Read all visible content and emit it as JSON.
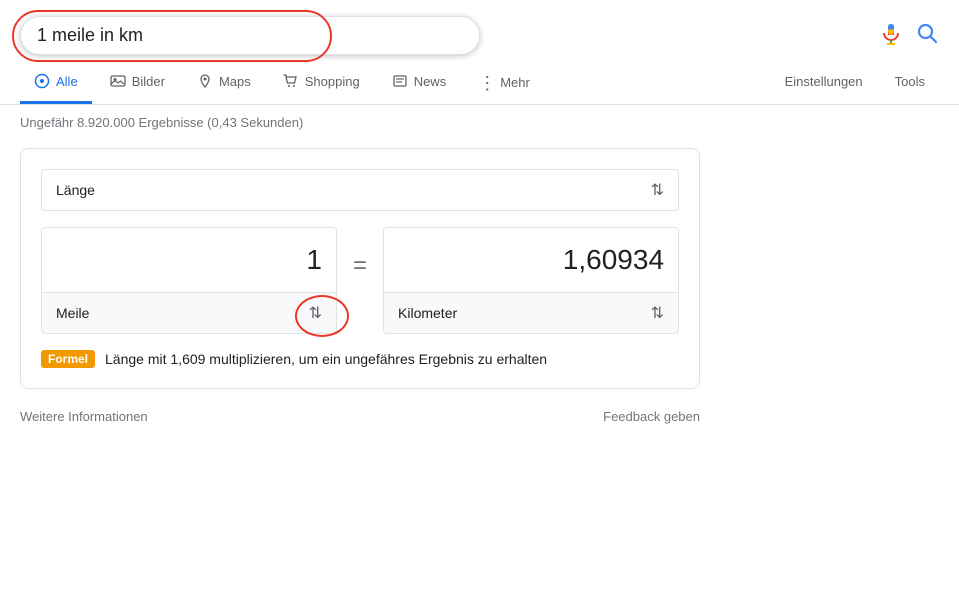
{
  "search": {
    "query": "1 meile in km",
    "mic_label": "Spracheingabe",
    "search_label": "Google Suche"
  },
  "nav": {
    "tabs": [
      {
        "id": "alle",
        "label": "Alle",
        "active": true
      },
      {
        "id": "bilder",
        "label": "Bilder",
        "active": false
      },
      {
        "id": "maps",
        "label": "Maps",
        "active": false
      },
      {
        "id": "shopping",
        "label": "Shopping",
        "active": false
      },
      {
        "id": "news",
        "label": "News",
        "active": false
      },
      {
        "id": "mehr",
        "label": "Mehr",
        "active": false
      }
    ],
    "settings_label": "Einstellungen",
    "tools_label": "Tools"
  },
  "results": {
    "count_text": "Ungefähr 8.920.000 Ergebnisse (0,43 Sekunden)"
  },
  "converter": {
    "category_label": "Länge",
    "from_value": "1",
    "to_value": "1,60934",
    "from_unit": "Meile",
    "to_unit": "Kilometer",
    "equals": "=",
    "formula_badge": "Formel",
    "formula_text": "Länge mit 1,609 multiplizieren, um ein ungefähres Ergebnis zu erhalten"
  },
  "footer": {
    "more_info": "Weitere Informationen",
    "feedback": "Feedback geben"
  },
  "icons": {
    "search": "🔍",
    "images": "🖼",
    "maps": "📍",
    "shopping": "🛍",
    "news": "📰",
    "more_dots": "⋮"
  }
}
